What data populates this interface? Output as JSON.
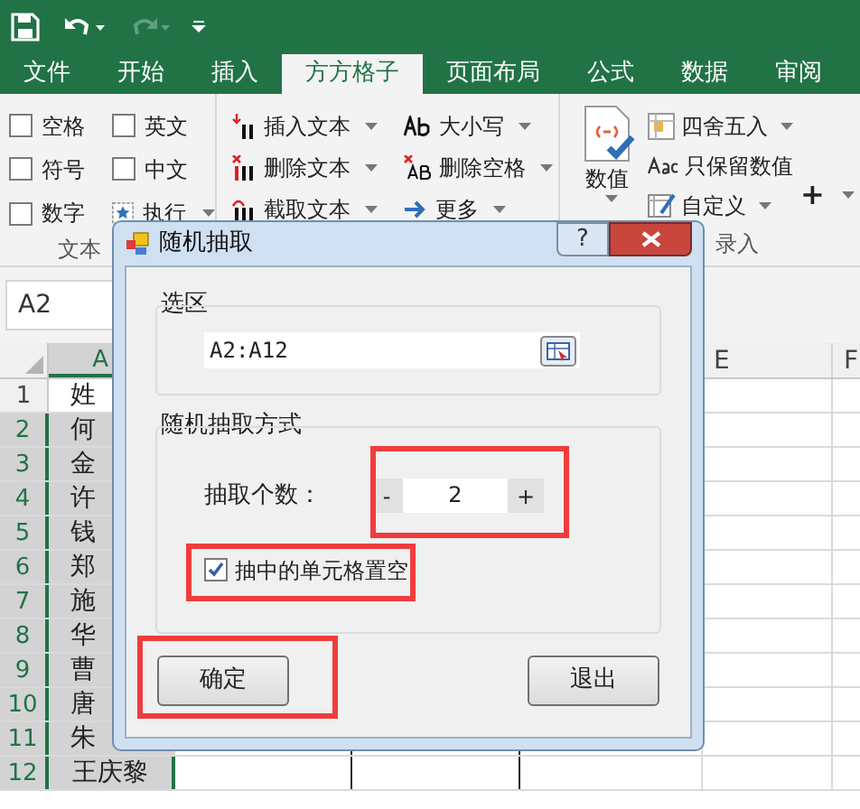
{
  "tabs": [
    {
      "label": "文件",
      "selected": false
    },
    {
      "label": "开始",
      "selected": false
    },
    {
      "label": "插入",
      "selected": false
    },
    {
      "label": "方方格子",
      "selected": true
    },
    {
      "label": "页面布局",
      "selected": false
    },
    {
      "label": "公式",
      "selected": false
    },
    {
      "label": "数据",
      "selected": false
    },
    {
      "label": "审阅",
      "selected": false
    }
  ],
  "ribbon": {
    "options": [
      {
        "label": "空格",
        "checked": false
      },
      {
        "label": "英文",
        "checked": false
      },
      {
        "label": "符号",
        "checked": false
      },
      {
        "label": "中文",
        "checked": false
      },
      {
        "label": "数字",
        "checked": false
      }
    ],
    "execute": "执行",
    "group_label_left": "文本",
    "text_tools": [
      {
        "kind": "insert",
        "label": "插入文本"
      },
      {
        "kind": "delete",
        "label": "删除文本"
      },
      {
        "kind": "cut",
        "label": "截取文本"
      }
    ],
    "format_tools": [
      {
        "kind": "case",
        "label": "大小写"
      },
      {
        "kind": "space",
        "label": "删除空格"
      },
      {
        "kind": "more",
        "label": "更多"
      }
    ],
    "numeric": "数值",
    "number_tools": [
      {
        "kind": "round",
        "label": "四舍五入",
        "dropdown": true
      },
      {
        "kind": "keep",
        "label": "只保留数值",
        "dropdown": false
      },
      {
        "kind": "custom",
        "label": "自定义",
        "dropdown": true
      }
    ],
    "plus": "+",
    "group_label_right": "录入"
  },
  "name_box": "A2",
  "columns": [
    {
      "label": "A",
      "kind": "partial"
    },
    {
      "label": "E",
      "kind": "full"
    },
    {
      "label": "F",
      "kind": "full"
    }
  ],
  "rows": [
    {
      "number": "1",
      "cell": "姓",
      "selected": false
    },
    {
      "number": "2",
      "cell": "何",
      "selected": true
    },
    {
      "number": "3",
      "cell": "金",
      "selected": true
    },
    {
      "number": "4",
      "cell": "许",
      "selected": true
    },
    {
      "number": "5",
      "cell": "钱",
      "selected": true
    },
    {
      "number": "6",
      "cell": "郑",
      "selected": true
    },
    {
      "number": "7",
      "cell": "施",
      "selected": true
    },
    {
      "number": "8",
      "cell": "华",
      "selected": true
    },
    {
      "number": "9",
      "cell": "曹",
      "selected": true
    },
    {
      "number": "10",
      "cell": "唐",
      "selected": true
    },
    {
      "number": "11",
      "cell": "朱",
      "selected": true
    },
    {
      "number": "12",
      "cell": "王庆黎",
      "selected": true
    }
  ],
  "dialog": {
    "title": "随机抽取",
    "help": "?",
    "range_group": {
      "label": "选区",
      "value": "A2:A12"
    },
    "method_group": {
      "label": "随机抽取方式",
      "count_label": "抽取个数：",
      "decrement": "-",
      "count": "2",
      "increment": "+",
      "clear_option": {
        "label": "抽中的单元格置空",
        "checked": true
      }
    },
    "buttons": [
      "确定",
      "退出"
    ]
  }
}
